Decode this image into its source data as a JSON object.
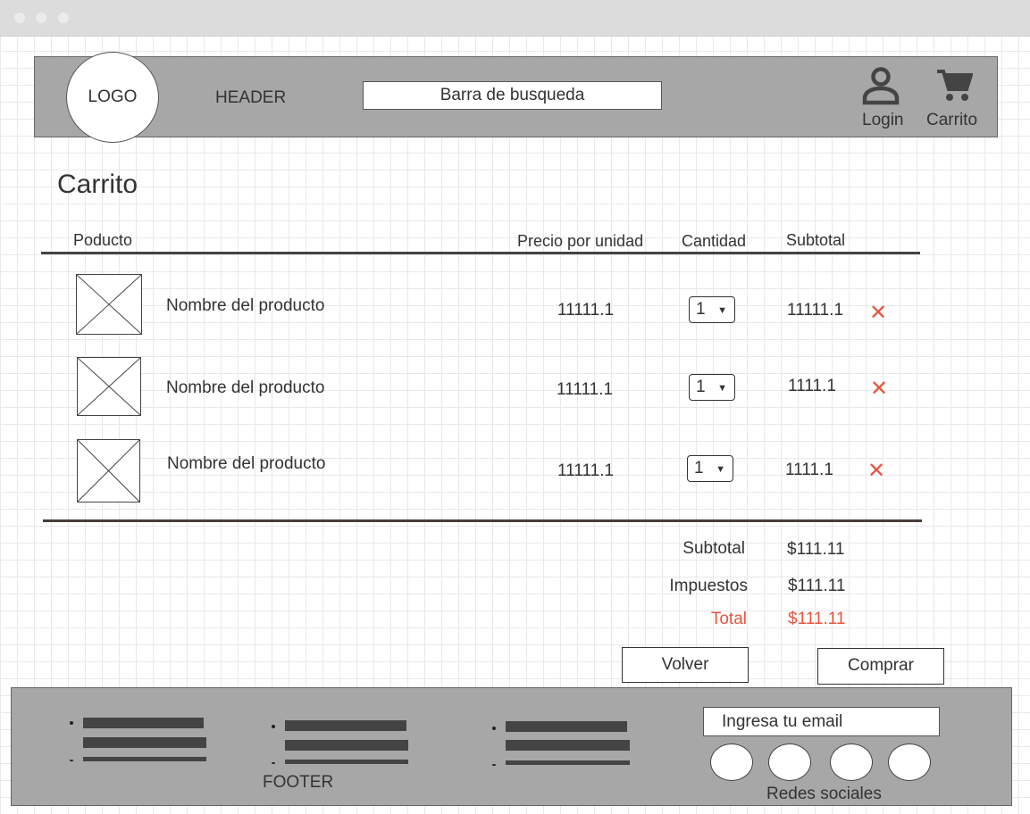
{
  "header": {
    "logo": "LOGO",
    "label": "HEADER",
    "search_text": "Barra de busqueda",
    "login_label": "Login",
    "cart_label": "Carrito"
  },
  "cart": {
    "title": "Carrito",
    "columns": {
      "product": "Poducto",
      "unit_price": "Precio por unidad",
      "quantity": "Cantidad",
      "subtotal": "Subtotal"
    },
    "items": [
      {
        "name": "Nombre del producto",
        "unit_price": "11111.1",
        "quantity": "1",
        "subtotal": "11111.1"
      },
      {
        "name": "Nombre del producto",
        "unit_price": "11111.1",
        "quantity": "1",
        "subtotal": "1111.1"
      },
      {
        "name": "Nombre del producto",
        "unit_price": "11111.1",
        "quantity": "1",
        "subtotal": "1111.1"
      }
    ],
    "remove_icon": "✕"
  },
  "summary": {
    "subtotal_label": "Subtotal",
    "subtotal_value": "$111.11",
    "tax_label": "Impuestos",
    "tax_value": "$111.11",
    "total_label": "Total",
    "total_value": "$111.11"
  },
  "actions": {
    "back": "Volver",
    "buy": "Comprar"
  },
  "footer": {
    "label": "FOOTER",
    "email_text": "Ingresa tu email",
    "social_label": "Redes sociales"
  },
  "colors": {
    "accent": "#e8553e",
    "panel": "#a7a7a7",
    "bar": "#444444"
  }
}
